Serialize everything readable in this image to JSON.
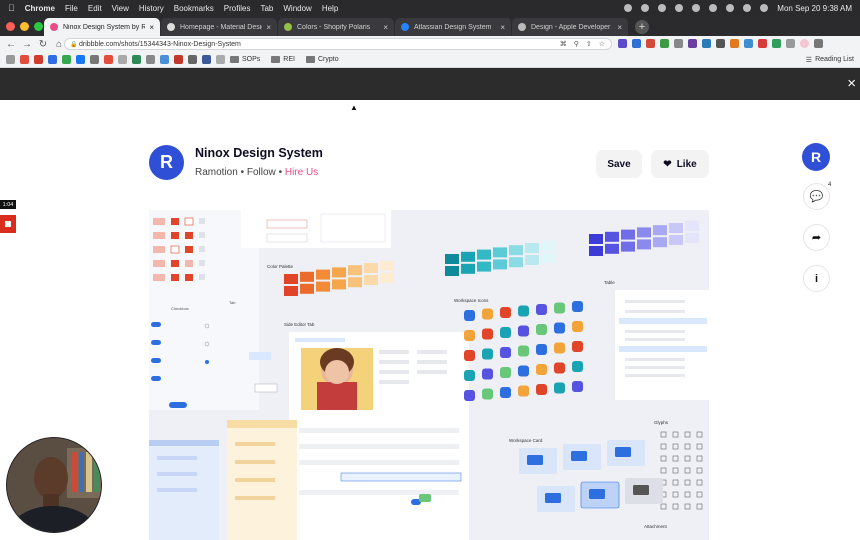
{
  "menubar": {
    "app": "Chrome",
    "items": [
      "File",
      "Edit",
      "View",
      "History",
      "Bookmarks",
      "Profiles",
      "Tab",
      "Window",
      "Help"
    ],
    "datetime": "Mon Sep 20  9:38 AM"
  },
  "tabs": [
    {
      "title": "Ninox Design System by Ramotion",
      "active": true,
      "color": "#ea4c89"
    },
    {
      "title": "Homepage - Material Design",
      "active": false,
      "color": "#9e9e9e"
    },
    {
      "title": "Colors - Shopify Polaris",
      "active": false,
      "color": "#95bf47"
    },
    {
      "title": "Atlassian Design System",
      "active": false,
      "color": "#0052cc"
    },
    {
      "title": "Design - Apple Developer",
      "active": false,
      "color": "#9e9e9e"
    }
  ],
  "address": {
    "url": "dribbble.com/shots/15344343-Ninox-Design-System"
  },
  "bookmarks": {
    "folders": [
      "SOPs",
      "REI",
      "Crypto"
    ],
    "reading_list": "Reading List"
  },
  "shot": {
    "title": "Ninox Design System",
    "author": "Ramotion",
    "follow": "Follow",
    "hire": "Hire Us",
    "save_label": "Save",
    "like_label": "Like",
    "avatar_letter": "R",
    "comment_count": "4"
  },
  "recorder": {
    "time": "1:04"
  },
  "mockup": {
    "labels": {
      "tab": "Tab",
      "checkbox": "Checkbox",
      "color_palette": "Color Palette",
      "side_editor_tab": "Side Editor Tab",
      "workspace_icons": "Workspace Icons",
      "table": "Table",
      "workspace_card": "Workspace Card",
      "glyphs": "Glyphs",
      "attachment": "Attachment"
    }
  },
  "colors": {
    "accent": "#2e4fd6",
    "hire": "#ea4c89",
    "orange_palette": [
      "#e0452a",
      "#eb6a2c",
      "#f28a36",
      "#f5a64a",
      "#f8c27a",
      "#fbd9a8",
      "#fdebd2"
    ],
    "teal_palette": [
      "#0f8a9a",
      "#1aa3b3",
      "#33b8c6",
      "#5ccbd6",
      "#8adbe3",
      "#b8e9ee",
      "#e0f6f8"
    ],
    "purple_palette": [
      "#3d3bd6",
      "#5553e0",
      "#6f6de7",
      "#8b89ed",
      "#a9a8f2",
      "#c8c7f7",
      "#e4e4fb"
    ]
  }
}
